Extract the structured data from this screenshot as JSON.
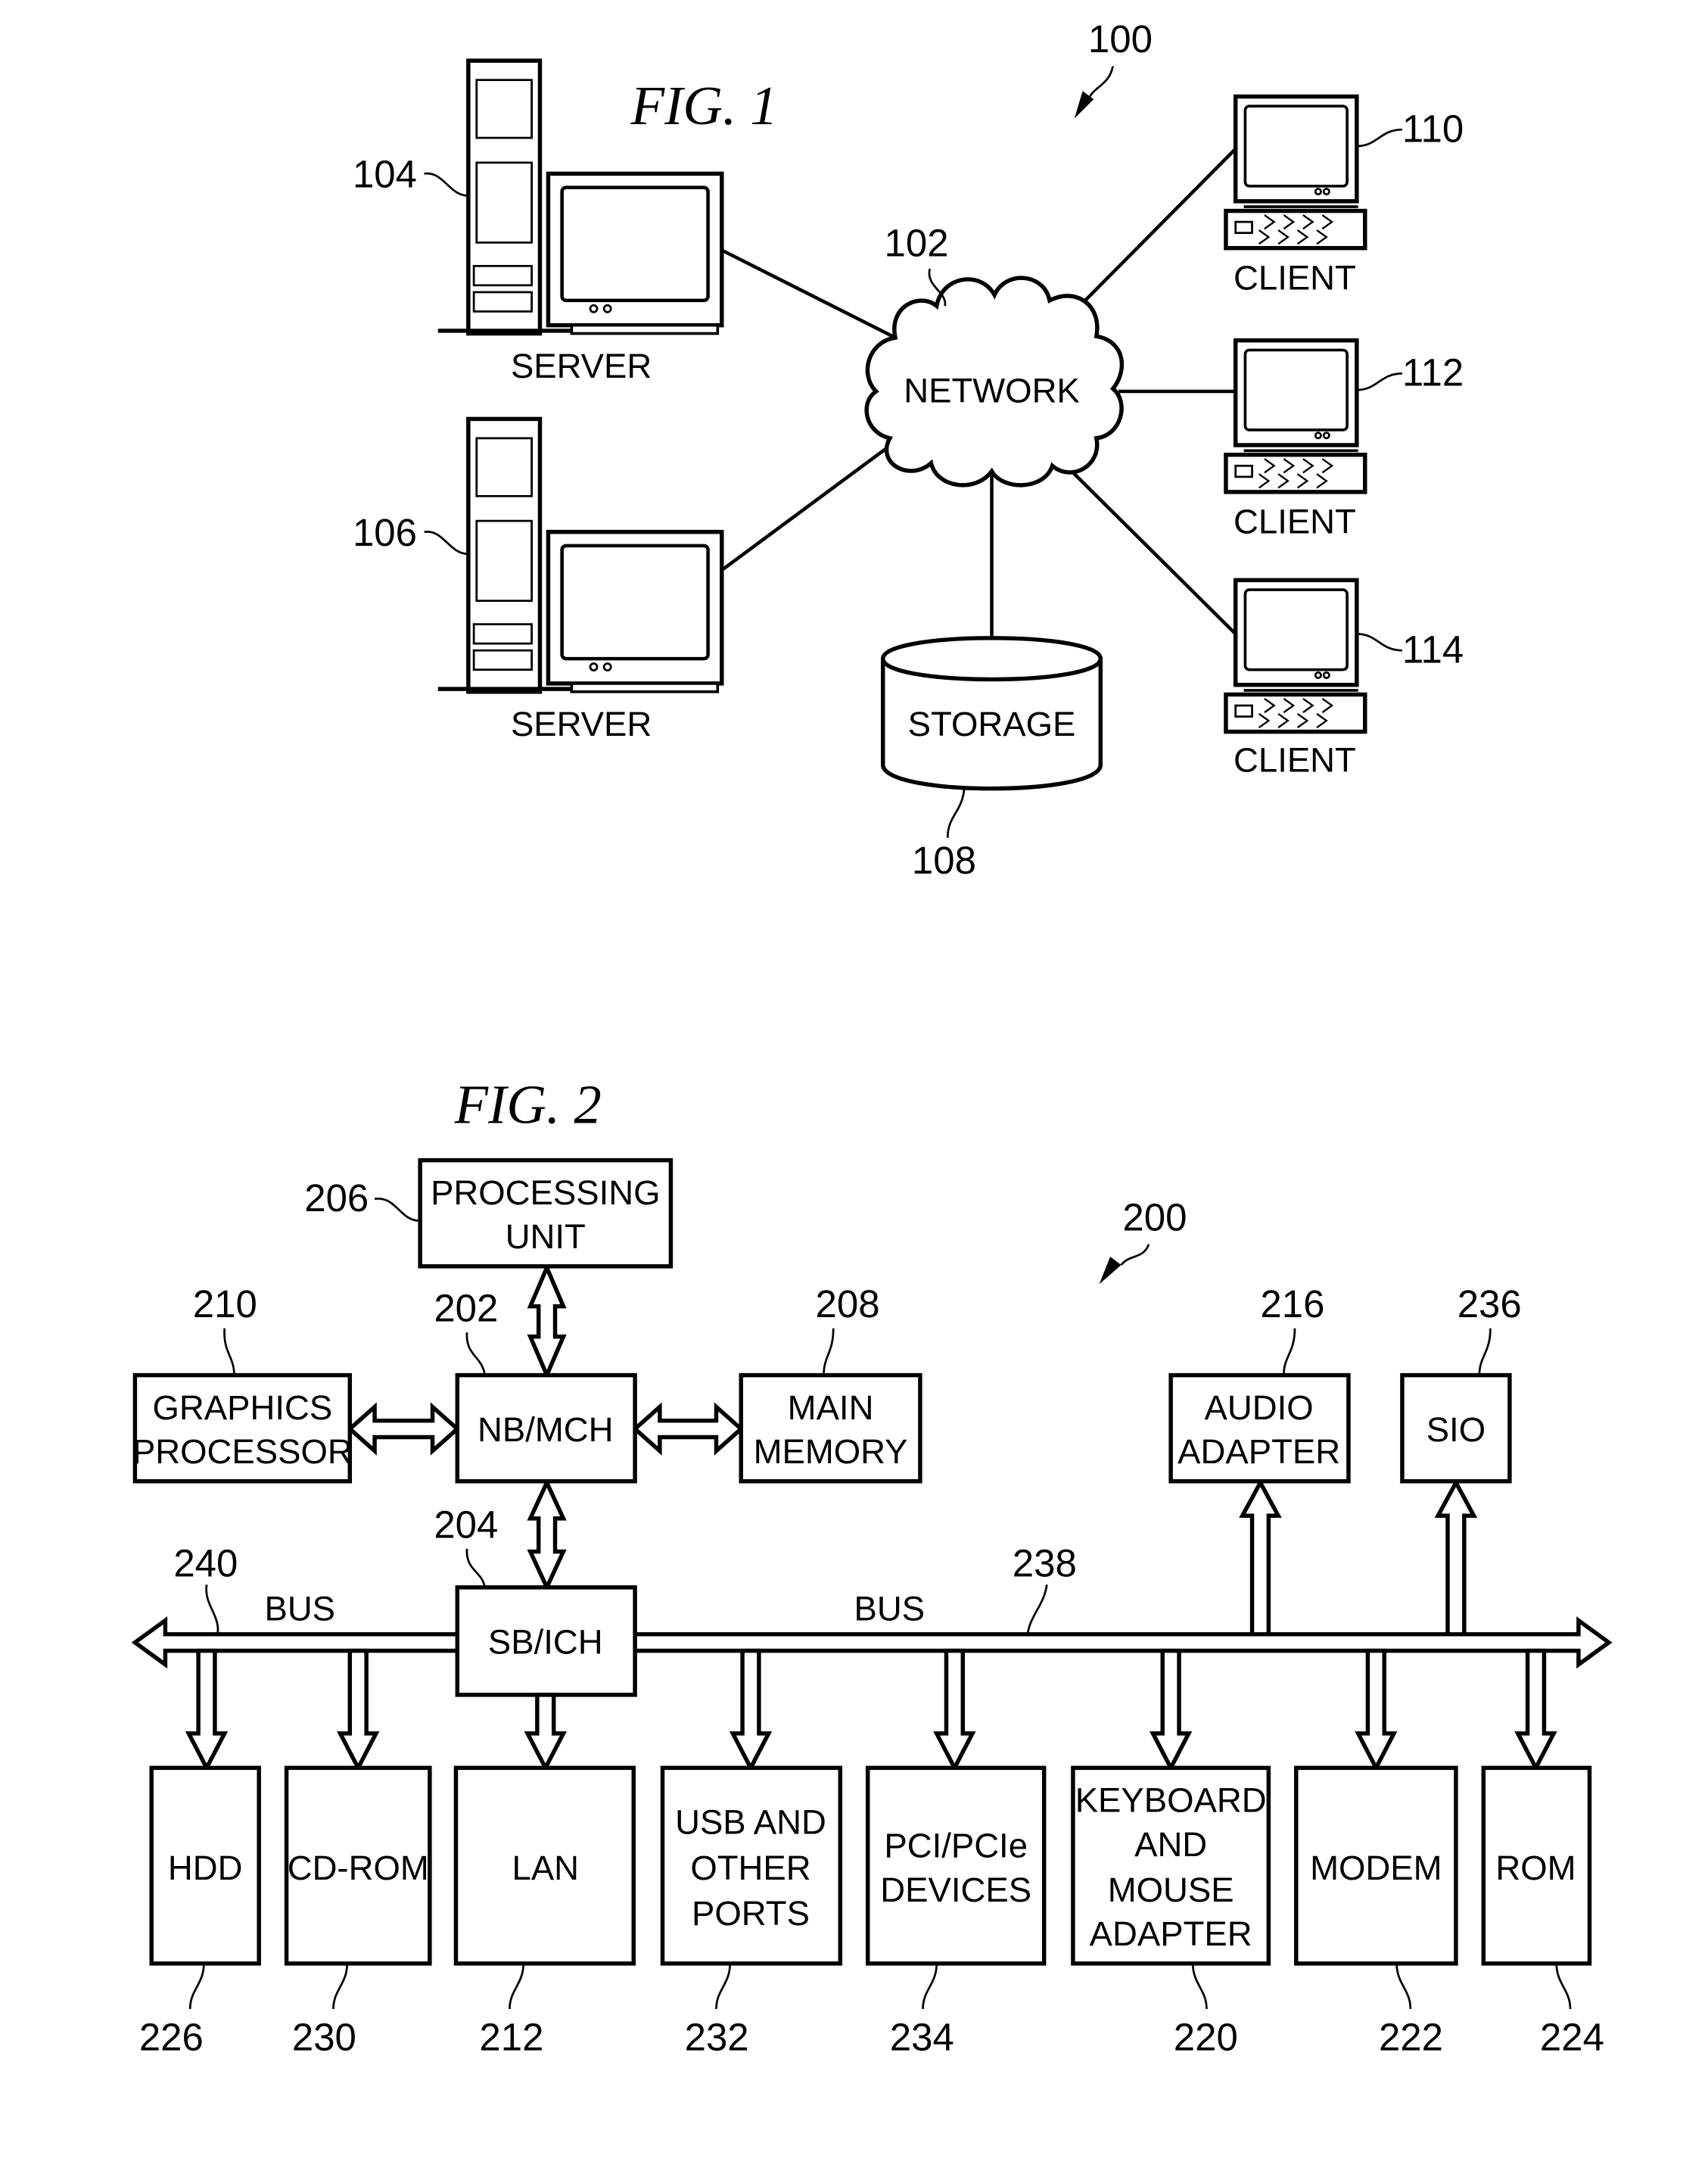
{
  "fig1": {
    "title": "FIG. 1",
    "system_ref": "100",
    "network": {
      "label": "NETWORK",
      "ref": "102"
    },
    "servers": [
      {
        "label": "SERVER",
        "ref": "104"
      },
      {
        "label": "SERVER",
        "ref": "106"
      }
    ],
    "storage": {
      "label": "STORAGE",
      "ref": "108"
    },
    "clients": [
      {
        "label": "CLIENT",
        "ref": "110"
      },
      {
        "label": "CLIENT",
        "ref": "112"
      },
      {
        "label": "CLIENT",
        "ref": "114"
      }
    ]
  },
  "fig2": {
    "title": "FIG. 2",
    "system_ref": "200",
    "processing_unit": {
      "lines": [
        "PROCESSING",
        "UNIT"
      ],
      "ref": "206"
    },
    "graphics_processor": {
      "lines": [
        "GRAPHICS",
        "PROCESSOR"
      ],
      "ref": "210"
    },
    "nb_mch": {
      "lines": [
        "NB/MCH"
      ],
      "ref": "202"
    },
    "main_memory": {
      "lines": [
        "MAIN",
        "MEMORY"
      ],
      "ref": "208"
    },
    "audio_adapter": {
      "lines": [
        "AUDIO",
        "ADAPTER"
      ],
      "ref": "216"
    },
    "sio": {
      "lines": [
        "SIO"
      ],
      "ref": "236"
    },
    "sb_ich": {
      "lines": [
        "SB/ICH"
      ],
      "ref": "204"
    },
    "bus_left": {
      "label": "BUS",
      "ref": "240"
    },
    "bus_right": {
      "label": "BUS",
      "ref": "238"
    },
    "devices": [
      {
        "lines": [
          "HDD"
        ],
        "ref": "226"
      },
      {
        "lines": [
          "CD-ROM"
        ],
        "ref": "230"
      },
      {
        "lines": [
          "LAN"
        ],
        "ref": "212"
      },
      {
        "lines": [
          "USB AND",
          "OTHER",
          "PORTS"
        ],
        "ref": "232"
      },
      {
        "lines": [
          "PCI/PCIe",
          "DEVICES"
        ],
        "ref": "234"
      },
      {
        "lines": [
          "KEYBOARD",
          "AND",
          "MOUSE",
          "ADAPTER"
        ],
        "ref": "220"
      },
      {
        "lines": [
          "MODEM"
        ],
        "ref": "222"
      },
      {
        "lines": [
          "ROM"
        ],
        "ref": "224"
      }
    ]
  }
}
